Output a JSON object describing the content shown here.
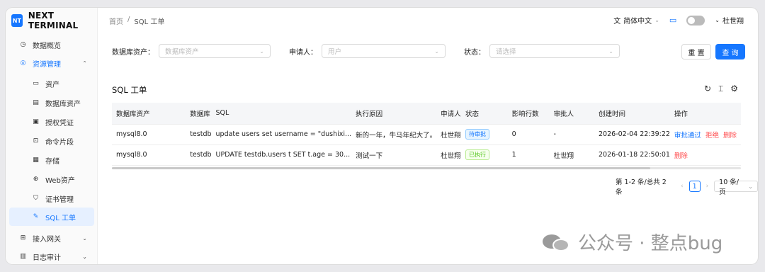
{
  "brand": {
    "logo": "NT",
    "name": "NEXT TERMINAL"
  },
  "sidebar": {
    "items": [
      {
        "label": "数据概览",
        "icon": "dashboard-icon"
      },
      {
        "label": "资源管理",
        "icon": "resource-icon"
      },
      {
        "label": "资产",
        "icon": "monitor-icon"
      },
      {
        "label": "数据库资产",
        "icon": "database-icon"
      },
      {
        "label": "授权凭证",
        "icon": "credential-icon"
      },
      {
        "label": "命令片段",
        "icon": "terminal-icon"
      },
      {
        "label": "存储",
        "icon": "storage-icon"
      },
      {
        "label": "Web资产",
        "icon": "globe-icon"
      },
      {
        "label": "证书管理",
        "icon": "shield-icon"
      },
      {
        "label": "SQL 工单",
        "icon": "edit-icon"
      },
      {
        "label": "接入网关",
        "icon": "gateway-icon"
      },
      {
        "label": "日志审计",
        "icon": "log-icon"
      }
    ]
  },
  "breadcrumb": {
    "home": "首页",
    "sep": "/",
    "current": "SQL 工单"
  },
  "topbar": {
    "language": "简体中文",
    "user": "杜世翔"
  },
  "filters": {
    "db_asset_label": "数据库资产：",
    "db_asset_placeholder": "数据库资产",
    "applicant_label": "申请人：",
    "applicant_placeholder": "用户",
    "status_label": "状态：",
    "status_placeholder": "请选择"
  },
  "buttons": {
    "reset": "重 置",
    "query": "查 询"
  },
  "table": {
    "title": "SQL 工单",
    "columns": [
      "数据库资产",
      "数据库",
      "SQL",
      "执行原因",
      "申请人",
      "状态",
      "影响行数",
      "审批人",
      "创建时间",
      "操作"
    ],
    "rows": [
      {
        "asset": "mysql8.0",
        "db": "testdb",
        "sql": "update users set username = \"dushixi...",
        "reason": "新的一年，牛马年纪大了。",
        "applicant": "杜世翔",
        "status": "待审批",
        "rows_affected": "0",
        "approver": "-",
        "created": "2026-02-04 22:39:22",
        "actions": [
          "审批通过",
          "拒绝",
          "删除"
        ]
      },
      {
        "asset": "mysql8.0",
        "db": "testdb",
        "sql": "UPDATE testdb.users t SET t.age = 30...",
        "reason": "测试一下",
        "applicant": "杜世翔",
        "status": "已执行",
        "rows_affected": "1",
        "approver": "杜世翔",
        "created": "2026-01-18 22:50:01",
        "actions": [
          "删除"
        ]
      }
    ]
  },
  "pagination": {
    "summary": "第 1-2 条/总共 2 条",
    "page": "1",
    "page_size": "10 条/页"
  },
  "watermark": {
    "text": "公众号 · 整点bug"
  },
  "colors": {
    "primary": "#1677ff",
    "danger": "#ff4d4f",
    "success": "#52c41a"
  }
}
